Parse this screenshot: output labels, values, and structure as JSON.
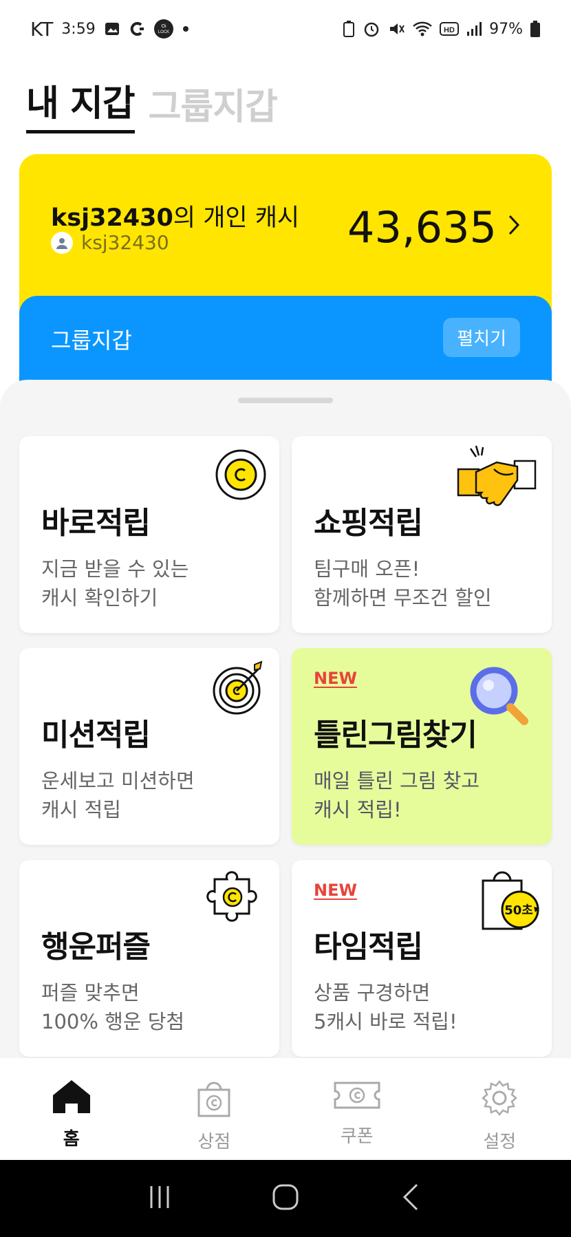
{
  "status_bar": {
    "carrier": "KT",
    "time": "3:59",
    "lock_badge": "Oi LOCK",
    "battery": "97%"
  },
  "wallet_tabs": {
    "my_wallet": "내 지갑",
    "group_wallet": "그룹지갑"
  },
  "cash_card": {
    "owner": "ksj32430",
    "title_suffix": "의 개인 캐시",
    "username": "ksj32430",
    "amount": "43,635",
    "color": "#ffe500"
  },
  "group_card": {
    "title": "그룹지갑",
    "expand_label": "펼치기",
    "color": "#0b96ff"
  },
  "tiles": [
    {
      "title": "바로적립",
      "desc1": "지금 받을 수 있는",
      "desc2": "캐시 확인하기",
      "icon": "coin-icon"
    },
    {
      "title": "쇼핑적립",
      "desc1": "팀구매 오픈!",
      "desc2": "함께하면 무조건 할인",
      "icon": "handshake-icon"
    },
    {
      "title": "미션적립",
      "desc1": "운세보고 미션하면",
      "desc2": "캐시 적립",
      "icon": "target-icon"
    },
    {
      "badge": "NEW",
      "title": "틀린그림찾기",
      "desc1": "매일 틀린 그림 찾고",
      "desc2": "캐시 적립!",
      "icon": "magnifier-icon"
    },
    {
      "title": "행운퍼즐",
      "desc1": "퍼즐 맞추면",
      "desc2": "100% 행운 당첨",
      "icon": "puzzle-icon"
    },
    {
      "badge": "NEW",
      "title": "타임적립",
      "desc1": "상품 구경하면",
      "desc2": "5캐시 바로 적립!",
      "icon": "shopping-bag-icon",
      "timer_label": "50초"
    }
  ],
  "bottom_nav": {
    "home": "홈",
    "store": "상점",
    "coupon": "쿠폰",
    "settings": "설정"
  }
}
